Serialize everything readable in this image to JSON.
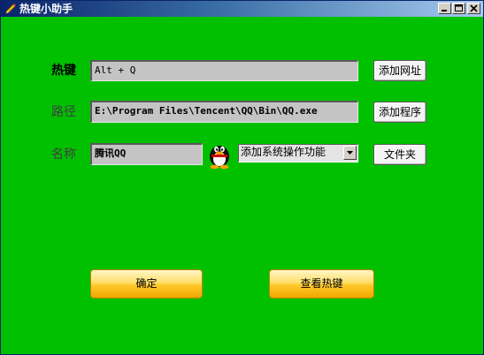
{
  "window": {
    "title": "热键小助手",
    "background_color": "#00c000",
    "titlebar_buttons": [
      "minimize-icon",
      "maximize-icon",
      "close-icon"
    ]
  },
  "labels": {
    "hotkey": "热键",
    "path": "路径",
    "name": "名称"
  },
  "fields": {
    "hotkey_value": "Alt + Q",
    "path_value": "E:\\Program Files\\Tencent\\QQ\\Bin\\QQ.exe",
    "name_value": "腾讯QQ"
  },
  "combo": {
    "selected": "添加系统操作功能",
    "icon": "chevron-down-icon"
  },
  "buttons": {
    "add_url": "添加网址",
    "add_program": "添加程序",
    "folder": "文件夹",
    "ok": "确定",
    "view_hotkeys": "查看热键"
  },
  "icons": {
    "app": "pencil-icon",
    "program": "qq-penguin-icon"
  }
}
